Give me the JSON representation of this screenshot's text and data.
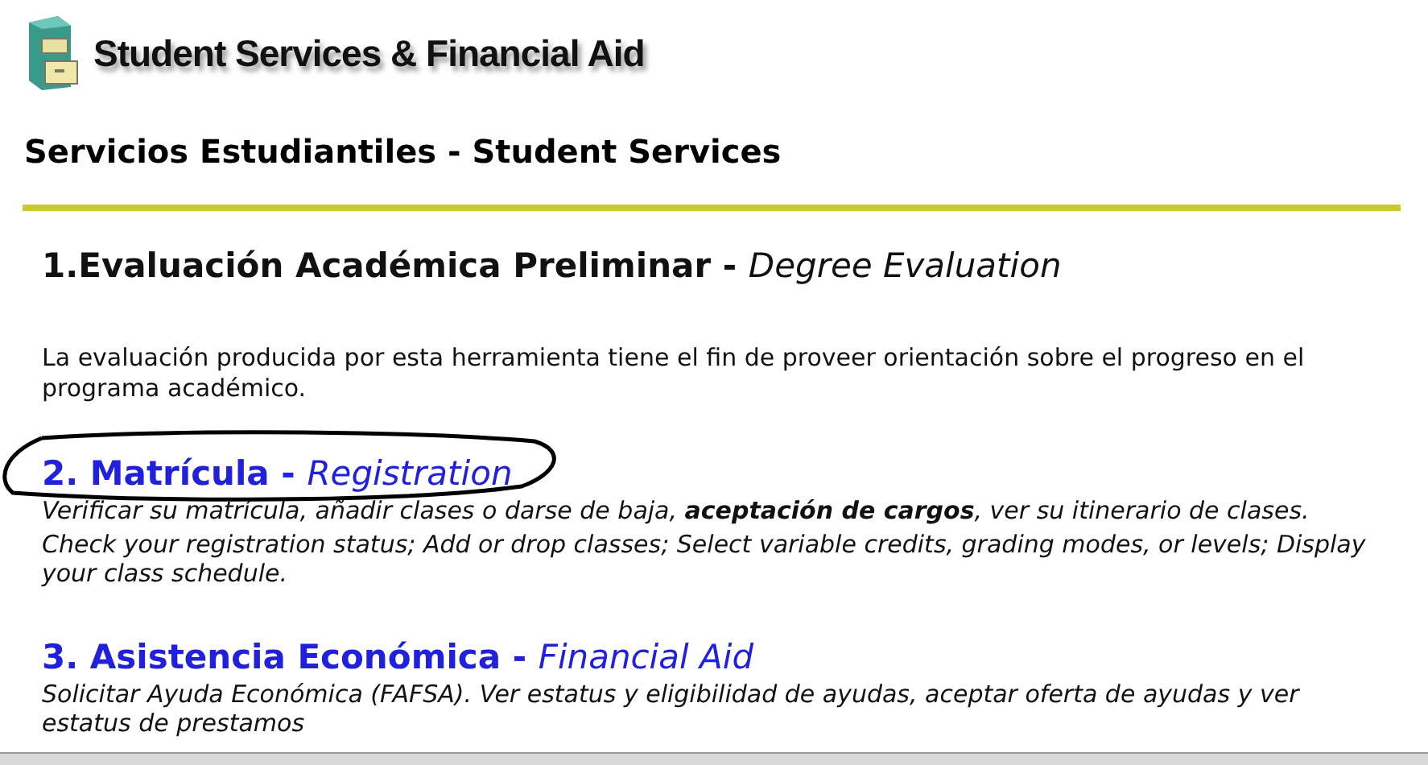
{
  "logo": {
    "text": "Student Services & Financial Aid"
  },
  "heading": "Servicios Estudiantiles - Student Services",
  "sections": [
    {
      "number": "1.",
      "title": "Evaluación Académica Preliminar",
      "separator": "-",
      "subtitle": "Degree Evaluation",
      "link": false,
      "circled": false,
      "lines": [
        "La evaluación producida por esta herramienta tiene el fin de proveer orientación sobre el progreso en el programa académico."
      ]
    },
    {
      "number": "2. ",
      "title": "Matrícula",
      "separator": "-",
      "subtitle": "Registration",
      "link": true,
      "circled": true,
      "lines": [
        "Verificar su matrícula, añadir clases o darse de baja, **aceptación de cargos**, ver su itinerario de clases.",
        "Check your registration status; Add or drop classes; Select variable credits, grading modes, or levels; Display your class schedule."
      ]
    },
    {
      "number": "3. ",
      "title": "Asistencia Económica",
      "separator": "-",
      "subtitle": "Financial Aid",
      "link": true,
      "circled": false,
      "lines": [
        "Solicitar Ayuda Económica (FAFSA). Ver estatus y eligibilidad de ayudas, aceptar oferta de ayudas y ver estatus de prestamos"
      ]
    }
  ]
}
